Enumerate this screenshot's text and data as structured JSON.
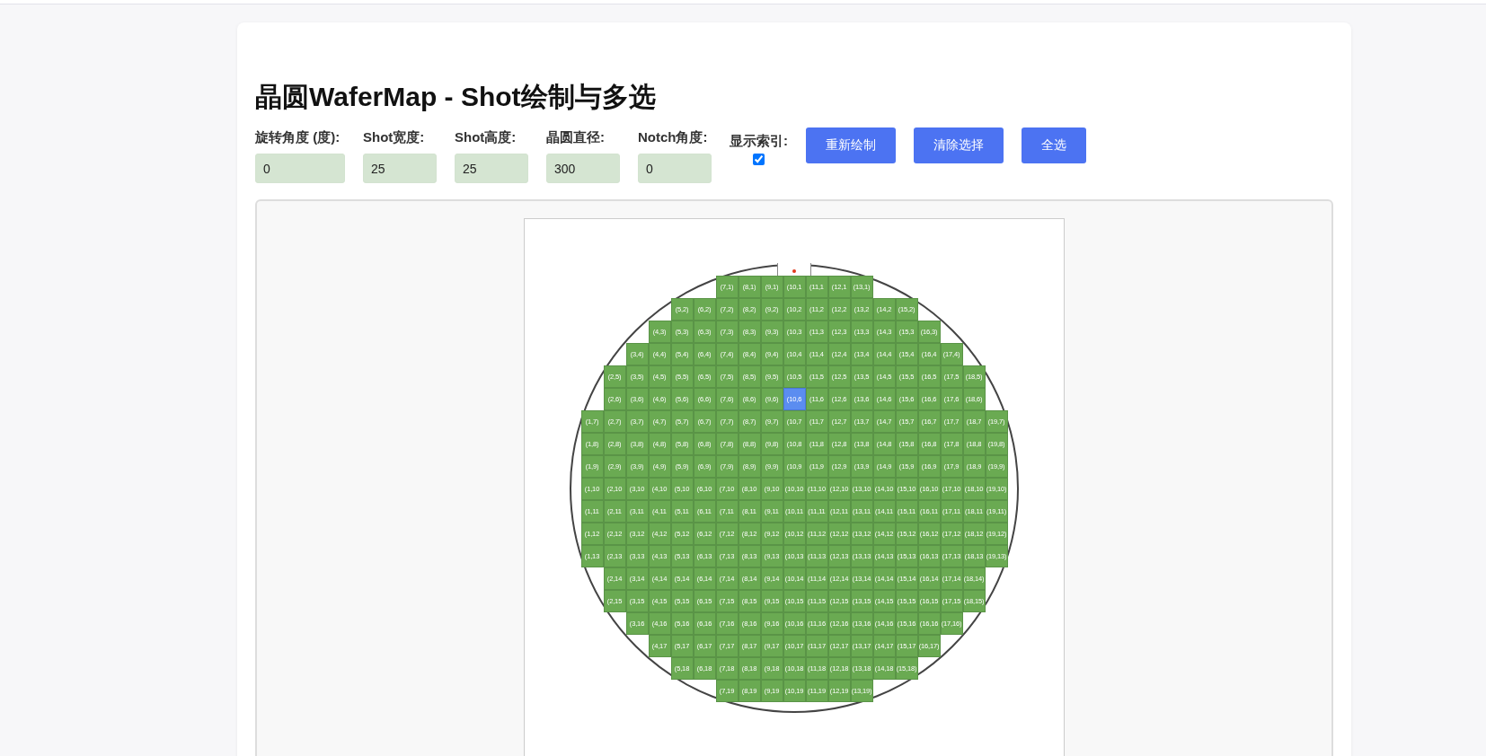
{
  "title": "晶圆WaferMap - Shot绘制与多选",
  "fields": [
    {
      "label": "旋转角度 (度):",
      "value": "0"
    },
    {
      "label": "Shot宽度:",
      "value": "25"
    },
    {
      "label": "Shot高度:",
      "value": "25"
    },
    {
      "label": "晶圆直径:",
      "value": "300"
    },
    {
      "label": "Notch角度:",
      "value": "0"
    }
  ],
  "show_index": {
    "label": "显示索引:",
    "checked": true
  },
  "buttons": [
    "重新绘制",
    "清除选择",
    "全选"
  ],
  "wafer_rows": [
    {
      "shots": [
        {
          "label": "(7,1)",
          "selected": false
        },
        {
          "label": "(8,1)",
          "selected": false
        },
        {
          "label": "(9,1)",
          "selected": false
        },
        {
          "label": "(10,1",
          "selected": false
        },
        {
          "label": "(11,1",
          "selected": false
        },
        {
          "label": "(12,1",
          "selected": false
        },
        {
          "label": "(13,1)",
          "selected": false
        }
      ]
    },
    {
      "shots": [
        {
          "label": "(5,2)",
          "selected": false
        },
        {
          "label": "(6,2)",
          "selected": false
        },
        {
          "label": "(7,2)",
          "selected": false
        },
        {
          "label": "(8,2)",
          "selected": false
        },
        {
          "label": "(9,2)",
          "selected": false
        },
        {
          "label": "(10,2",
          "selected": false
        },
        {
          "label": "(11,2",
          "selected": false
        },
        {
          "label": "(12,2",
          "selected": false
        },
        {
          "label": "(13,2",
          "selected": false
        },
        {
          "label": "(14,2",
          "selected": false
        },
        {
          "label": "(15,2)",
          "selected": false
        }
      ]
    },
    {
      "shots": [
        {
          "label": "(4,3)",
          "selected": false
        },
        {
          "label": "(5,3)",
          "selected": false
        },
        {
          "label": "(6,3)",
          "selected": false
        },
        {
          "label": "(7,3)",
          "selected": false
        },
        {
          "label": "(8,3)",
          "selected": false
        },
        {
          "label": "(9,3)",
          "selected": false
        },
        {
          "label": "(10,3",
          "selected": false
        },
        {
          "label": "(11,3",
          "selected": false
        },
        {
          "label": "(12,3",
          "selected": false
        },
        {
          "label": "(13,3",
          "selected": false
        },
        {
          "label": "(14,3",
          "selected": false
        },
        {
          "label": "(15,3",
          "selected": false
        },
        {
          "label": "(16,3)",
          "selected": false
        }
      ]
    },
    {
      "shots": [
        {
          "label": "(3,4)",
          "selected": false
        },
        {
          "label": "(4,4)",
          "selected": false
        },
        {
          "label": "(5,4)",
          "selected": false
        },
        {
          "label": "(6,4)",
          "selected": false
        },
        {
          "label": "(7,4)",
          "selected": false
        },
        {
          "label": "(8,4)",
          "selected": false
        },
        {
          "label": "(9,4)",
          "selected": false
        },
        {
          "label": "(10,4",
          "selected": false
        },
        {
          "label": "(11,4",
          "selected": false
        },
        {
          "label": "(12,4",
          "selected": false
        },
        {
          "label": "(13,4",
          "selected": false
        },
        {
          "label": "(14,4",
          "selected": false
        },
        {
          "label": "(15,4",
          "selected": false
        },
        {
          "label": "(16,4",
          "selected": false
        },
        {
          "label": "(17,4)",
          "selected": false
        }
      ]
    },
    {
      "shots": [
        {
          "label": "(2,5)",
          "selected": false
        },
        {
          "label": "(3,5)",
          "selected": false
        },
        {
          "label": "(4,5)",
          "selected": false
        },
        {
          "label": "(5,5)",
          "selected": false
        },
        {
          "label": "(6,5)",
          "selected": false
        },
        {
          "label": "(7,5)",
          "selected": false
        },
        {
          "label": "(8,5)",
          "selected": false
        },
        {
          "label": "(9,5)",
          "selected": false
        },
        {
          "label": "(10,5",
          "selected": false
        },
        {
          "label": "(11,5",
          "selected": false
        },
        {
          "label": "(12,5",
          "selected": false
        },
        {
          "label": "(13,5",
          "selected": false
        },
        {
          "label": "(14,5",
          "selected": false
        },
        {
          "label": "(15,5",
          "selected": false
        },
        {
          "label": "(16,5",
          "selected": false
        },
        {
          "label": "(17,5",
          "selected": false
        },
        {
          "label": "(18,5)",
          "selected": false
        }
      ]
    },
    {
      "shots": [
        {
          "label": "(2,6)",
          "selected": false
        },
        {
          "label": "(3,6)",
          "selected": false
        },
        {
          "label": "(4,6)",
          "selected": false
        },
        {
          "label": "(5,6)",
          "selected": false
        },
        {
          "label": "(6,6)",
          "selected": false
        },
        {
          "label": "(7,6)",
          "selected": false
        },
        {
          "label": "(8,6)",
          "selected": false
        },
        {
          "label": "(9,6)",
          "selected": false
        },
        {
          "label": "(10,6",
          "selected": true
        },
        {
          "label": "(11,6",
          "selected": false
        },
        {
          "label": "(12,6",
          "selected": false
        },
        {
          "label": "(13,6",
          "selected": false
        },
        {
          "label": "(14,6",
          "selected": false
        },
        {
          "label": "(15,6",
          "selected": false
        },
        {
          "label": "(16,6",
          "selected": false
        },
        {
          "label": "(17,6",
          "selected": false
        },
        {
          "label": "(18,6)",
          "selected": false
        }
      ]
    },
    {
      "shots": [
        {
          "label": "(1,7)",
          "selected": false
        },
        {
          "label": "(2,7)",
          "selected": false
        },
        {
          "label": "(3,7)",
          "selected": false
        },
        {
          "label": "(4,7)",
          "selected": false
        },
        {
          "label": "(5,7)",
          "selected": false
        },
        {
          "label": "(6,7)",
          "selected": false
        },
        {
          "label": "(7,7)",
          "selected": false
        },
        {
          "label": "(8,7)",
          "selected": false
        },
        {
          "label": "(9,7)",
          "selected": false
        },
        {
          "label": "(10,7",
          "selected": false
        },
        {
          "label": "(11,7",
          "selected": false
        },
        {
          "label": "(12,7",
          "selected": false
        },
        {
          "label": "(13,7",
          "selected": false
        },
        {
          "label": "(14,7",
          "selected": false
        },
        {
          "label": "(15,7",
          "selected": false
        },
        {
          "label": "(16,7",
          "selected": false
        },
        {
          "label": "(17,7",
          "selected": false
        },
        {
          "label": "(18,7",
          "selected": false
        },
        {
          "label": "(19,7)",
          "selected": false
        }
      ]
    },
    {
      "shots": [
        {
          "label": "(1,8)",
          "selected": false
        },
        {
          "label": "(2,8)",
          "selected": false
        },
        {
          "label": "(3,8)",
          "selected": false
        },
        {
          "label": "(4,8)",
          "selected": false
        },
        {
          "label": "(5,8)",
          "selected": false
        },
        {
          "label": "(6,8)",
          "selected": false
        },
        {
          "label": "(7,8)",
          "selected": false
        },
        {
          "label": "(8,8)",
          "selected": false
        },
        {
          "label": "(9,8)",
          "selected": false
        },
        {
          "label": "(10,8",
          "selected": false
        },
        {
          "label": "(11,8",
          "selected": false
        },
        {
          "label": "(12,8",
          "selected": false
        },
        {
          "label": "(13,8",
          "selected": false
        },
        {
          "label": "(14,8",
          "selected": false
        },
        {
          "label": "(15,8",
          "selected": false
        },
        {
          "label": "(16,8",
          "selected": false
        },
        {
          "label": "(17,8",
          "selected": false
        },
        {
          "label": "(18,8",
          "selected": false
        },
        {
          "label": "(19,8)",
          "selected": false
        }
      ]
    },
    {
      "shots": [
        {
          "label": "(1,9)",
          "selected": false
        },
        {
          "label": "(2,9)",
          "selected": false
        },
        {
          "label": "(3,9)",
          "selected": false
        },
        {
          "label": "(4,9)",
          "selected": false
        },
        {
          "label": "(5,9)",
          "selected": false
        },
        {
          "label": "(6,9)",
          "selected": false
        },
        {
          "label": "(7,9)",
          "selected": false
        },
        {
          "label": "(8,9)",
          "selected": false
        },
        {
          "label": "(9,9)",
          "selected": false
        },
        {
          "label": "(10,9",
          "selected": false
        },
        {
          "label": "(11,9",
          "selected": false
        },
        {
          "label": "(12,9",
          "selected": false
        },
        {
          "label": "(13,9",
          "selected": false
        },
        {
          "label": "(14,9",
          "selected": false
        },
        {
          "label": "(15,9",
          "selected": false
        },
        {
          "label": "(16,9",
          "selected": false
        },
        {
          "label": "(17,9",
          "selected": false
        },
        {
          "label": "(18,9",
          "selected": false
        },
        {
          "label": "(19,9)",
          "selected": false
        }
      ]
    },
    {
      "shots": [
        {
          "label": "(1,10",
          "selected": false
        },
        {
          "label": "(2,10",
          "selected": false
        },
        {
          "label": "(3,10",
          "selected": false
        },
        {
          "label": "(4,10",
          "selected": false
        },
        {
          "label": "(5,10",
          "selected": false
        },
        {
          "label": "(6,10",
          "selected": false
        },
        {
          "label": "(7,10",
          "selected": false
        },
        {
          "label": "(8,10",
          "selected": false
        },
        {
          "label": "(9,10",
          "selected": false
        },
        {
          "label": "(10,10",
          "selected": false
        },
        {
          "label": "(11,10",
          "selected": false
        },
        {
          "label": "(12,10",
          "selected": false
        },
        {
          "label": "(13,10",
          "selected": false
        },
        {
          "label": "(14,10",
          "selected": false
        },
        {
          "label": "(15,10",
          "selected": false
        },
        {
          "label": "(16,10",
          "selected": false
        },
        {
          "label": "(17,10",
          "selected": false
        },
        {
          "label": "(18,10",
          "selected": false
        },
        {
          "label": "(19,10)",
          "selected": false
        }
      ]
    },
    {
      "shots": [
        {
          "label": "(1,11",
          "selected": false
        },
        {
          "label": "(2,11",
          "selected": false
        },
        {
          "label": "(3,11",
          "selected": false
        },
        {
          "label": "(4,11",
          "selected": false
        },
        {
          "label": "(5,11",
          "selected": false
        },
        {
          "label": "(6,11",
          "selected": false
        },
        {
          "label": "(7,11",
          "selected": false
        },
        {
          "label": "(8,11",
          "selected": false
        },
        {
          "label": "(9,11",
          "selected": false
        },
        {
          "label": "(10,11",
          "selected": false
        },
        {
          "label": "(11,11",
          "selected": false
        },
        {
          "label": "(12,11",
          "selected": false
        },
        {
          "label": "(13,11",
          "selected": false
        },
        {
          "label": "(14,11",
          "selected": false
        },
        {
          "label": "(15,11",
          "selected": false
        },
        {
          "label": "(16,11",
          "selected": false
        },
        {
          "label": "(17,11",
          "selected": false
        },
        {
          "label": "(18,11",
          "selected": false
        },
        {
          "label": "(19,11)",
          "selected": false
        }
      ]
    },
    {
      "shots": [
        {
          "label": "(1,12",
          "selected": false
        },
        {
          "label": "(2,12",
          "selected": false
        },
        {
          "label": "(3,12",
          "selected": false
        },
        {
          "label": "(4,12",
          "selected": false
        },
        {
          "label": "(5,12",
          "selected": false
        },
        {
          "label": "(6,12",
          "selected": false
        },
        {
          "label": "(7,12",
          "selected": false
        },
        {
          "label": "(8,12",
          "selected": false
        },
        {
          "label": "(9,12",
          "selected": false
        },
        {
          "label": "(10,12",
          "selected": false
        },
        {
          "label": "(11,12",
          "selected": false
        },
        {
          "label": "(12,12",
          "selected": false
        },
        {
          "label": "(13,12",
          "selected": false
        },
        {
          "label": "(14,12",
          "selected": false
        },
        {
          "label": "(15,12",
          "selected": false
        },
        {
          "label": "(16,12",
          "selected": false
        },
        {
          "label": "(17,12",
          "selected": false
        },
        {
          "label": "(18,12",
          "selected": false
        },
        {
          "label": "(19,12)",
          "selected": false
        }
      ]
    },
    {
      "shots": [
        {
          "label": "(1,13",
          "selected": false
        },
        {
          "label": "(2,13",
          "selected": false
        },
        {
          "label": "(3,13",
          "selected": false
        },
        {
          "label": "(4,13",
          "selected": false
        },
        {
          "label": "(5,13",
          "selected": false
        },
        {
          "label": "(6,13",
          "selected": false
        },
        {
          "label": "(7,13",
          "selected": false
        },
        {
          "label": "(8,13",
          "selected": false
        },
        {
          "label": "(9,13",
          "selected": false
        },
        {
          "label": "(10,13",
          "selected": false
        },
        {
          "label": "(11,13",
          "selected": false
        },
        {
          "label": "(12,13",
          "selected": false
        },
        {
          "label": "(13,13",
          "selected": false
        },
        {
          "label": "(14,13",
          "selected": false
        },
        {
          "label": "(15,13",
          "selected": false
        },
        {
          "label": "(16,13",
          "selected": false
        },
        {
          "label": "(17,13",
          "selected": false
        },
        {
          "label": "(18,13",
          "selected": false
        },
        {
          "label": "(19,13)",
          "selected": false
        }
      ]
    },
    {
      "shots": [
        {
          "label": "(2,14",
          "selected": false
        },
        {
          "label": "(3,14",
          "selected": false
        },
        {
          "label": "(4,14",
          "selected": false
        },
        {
          "label": "(5,14",
          "selected": false
        },
        {
          "label": "(6,14",
          "selected": false
        },
        {
          "label": "(7,14",
          "selected": false
        },
        {
          "label": "(8,14",
          "selected": false
        },
        {
          "label": "(9,14",
          "selected": false
        },
        {
          "label": "(10,14",
          "selected": false
        },
        {
          "label": "(11,14",
          "selected": false
        },
        {
          "label": "(12,14",
          "selected": false
        },
        {
          "label": "(13,14",
          "selected": false
        },
        {
          "label": "(14,14",
          "selected": false
        },
        {
          "label": "(15,14",
          "selected": false
        },
        {
          "label": "(16,14",
          "selected": false
        },
        {
          "label": "(17,14",
          "selected": false
        },
        {
          "label": "(18,14)",
          "selected": false
        }
      ]
    },
    {
      "shots": [
        {
          "label": "(2,15",
          "selected": false
        },
        {
          "label": "(3,15",
          "selected": false
        },
        {
          "label": "(4,15",
          "selected": false
        },
        {
          "label": "(5,15",
          "selected": false
        },
        {
          "label": "(6,15",
          "selected": false
        },
        {
          "label": "(7,15",
          "selected": false
        },
        {
          "label": "(8,15",
          "selected": false
        },
        {
          "label": "(9,15",
          "selected": false
        },
        {
          "label": "(10,15",
          "selected": false
        },
        {
          "label": "(11,15",
          "selected": false
        },
        {
          "label": "(12,15",
          "selected": false
        },
        {
          "label": "(13,15",
          "selected": false
        },
        {
          "label": "(14,15",
          "selected": false
        },
        {
          "label": "(15,15",
          "selected": false
        },
        {
          "label": "(16,15",
          "selected": false
        },
        {
          "label": "(17,15",
          "selected": false
        },
        {
          "label": "(18,15)",
          "selected": false
        }
      ]
    },
    {
      "shots": [
        {
          "label": "(3,16",
          "selected": false
        },
        {
          "label": "(4,16",
          "selected": false
        },
        {
          "label": "(5,16",
          "selected": false
        },
        {
          "label": "(6,16",
          "selected": false
        },
        {
          "label": "(7,16",
          "selected": false
        },
        {
          "label": "(8,16",
          "selected": false
        },
        {
          "label": "(9,16",
          "selected": false
        },
        {
          "label": "(10,16",
          "selected": false
        },
        {
          "label": "(11,16",
          "selected": false
        },
        {
          "label": "(12,16",
          "selected": false
        },
        {
          "label": "(13,16",
          "selected": false
        },
        {
          "label": "(14,16",
          "selected": false
        },
        {
          "label": "(15,16",
          "selected": false
        },
        {
          "label": "(16,16",
          "selected": false
        },
        {
          "label": "(17,16)",
          "selected": false
        }
      ]
    },
    {
      "shots": [
        {
          "label": "(4,17",
          "selected": false
        },
        {
          "label": "(5,17",
          "selected": false
        },
        {
          "label": "(6,17",
          "selected": false
        },
        {
          "label": "(7,17",
          "selected": false
        },
        {
          "label": "(8,17",
          "selected": false
        },
        {
          "label": "(9,17",
          "selected": false
        },
        {
          "label": "(10,17",
          "selected": false
        },
        {
          "label": "(11,17",
          "selected": false
        },
        {
          "label": "(12,17",
          "selected": false
        },
        {
          "label": "(13,17",
          "selected": false
        },
        {
          "label": "(14,17",
          "selected": false
        },
        {
          "label": "(15,17",
          "selected": false
        },
        {
          "label": "(16,17)",
          "selected": false
        }
      ]
    },
    {
      "shots": [
        {
          "label": "(5,18",
          "selected": false
        },
        {
          "label": "(6,18",
          "selected": false
        },
        {
          "label": "(7,18",
          "selected": false
        },
        {
          "label": "(8,18",
          "selected": false
        },
        {
          "label": "(9,18",
          "selected": false
        },
        {
          "label": "(10,18",
          "selected": false
        },
        {
          "label": "(11,18",
          "selected": false
        },
        {
          "label": "(12,18",
          "selected": false
        },
        {
          "label": "(13,18",
          "selected": false
        },
        {
          "label": "(14,18",
          "selected": false
        },
        {
          "label": "(15,18)",
          "selected": false
        }
      ]
    },
    {
      "shots": [
        {
          "label": "(7,19",
          "selected": false
        },
        {
          "label": "(8,19",
          "selected": false
        },
        {
          "label": "(9,19",
          "selected": false
        },
        {
          "label": "(10,19",
          "selected": false
        },
        {
          "label": "(11,19",
          "selected": false
        },
        {
          "label": "(12,19",
          "selected": false
        },
        {
          "label": "(13,19)",
          "selected": false
        }
      ]
    }
  ]
}
